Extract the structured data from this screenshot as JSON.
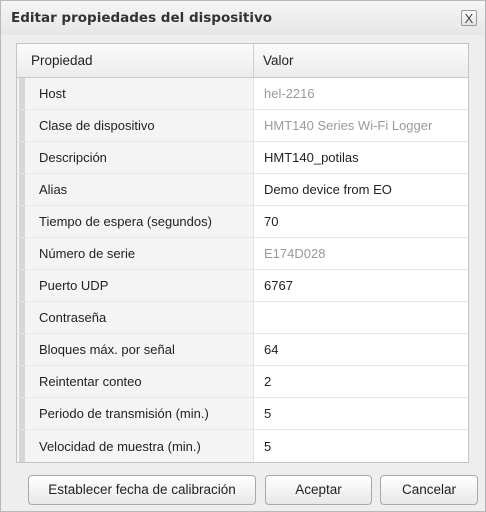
{
  "dialog": {
    "title": "Editar propiedades del dispositivo",
    "close_label": "X"
  },
  "grid": {
    "headers": {
      "property": "Propiedad",
      "value": "Valor"
    },
    "rows": [
      {
        "property": "Host",
        "value": "hel-2216",
        "readonly": true
      },
      {
        "property": "Clase de dispositivo",
        "value": "HMT140 Series Wi-Fi Logger",
        "readonly": true
      },
      {
        "property": "Descripción",
        "value": "HMT140_potilas",
        "readonly": false
      },
      {
        "property": "Alias",
        "value": "Demo device from EO",
        "readonly": false
      },
      {
        "property": "Tiempo de espera (segundos)",
        "value": "70",
        "readonly": false
      },
      {
        "property": "Número de serie",
        "value": "E174D028",
        "readonly": true
      },
      {
        "property": "Puerto UDP",
        "value": "6767",
        "readonly": false
      },
      {
        "property": "Contraseña",
        "value": "",
        "readonly": false
      },
      {
        "property": "Bloques máx. por señal",
        "value": "64",
        "readonly": false
      },
      {
        "property": "Reintentar conteo",
        "value": "2",
        "readonly": false
      },
      {
        "property": "Periodo de transmisión (min.)",
        "value": "5",
        "readonly": false
      },
      {
        "property": "Velocidad de muestra (min.)",
        "value": "5",
        "readonly": false
      }
    ]
  },
  "buttons": {
    "calibration_label": "Establecer fecha de calibración",
    "accept_label": "Aceptar",
    "cancel_label": "Cancelar"
  }
}
